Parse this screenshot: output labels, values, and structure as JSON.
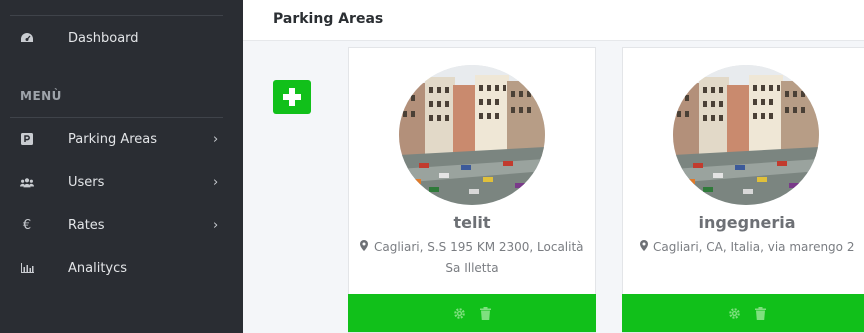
{
  "sidebar": {
    "dashboard": {
      "label": "Dashboard",
      "icon": "dashboard-gauge-icon"
    },
    "section_label": "MENÙ",
    "items": [
      {
        "label": "Parking Areas",
        "icon": "parking-icon",
        "chevron": "›"
      },
      {
        "label": "Users",
        "icon": "users-icon",
        "chevron": "›"
      },
      {
        "label": "Rates",
        "icon": "euro-icon",
        "chevron": "›"
      },
      {
        "label": "Analitycs",
        "icon": "bar-chart-icon"
      }
    ]
  },
  "header": {
    "title": "Parking Areas"
  },
  "add_button": {
    "icon": "plus-icon"
  },
  "cards": [
    {
      "name": "telit",
      "address": "Cagliari, S.S 195 KM 2300, Località Sa Illetta"
    },
    {
      "name": "ingegneria",
      "address": "Cagliari, CA, Italia, via marengo 2"
    }
  ],
  "colors": {
    "sidebar_bg": "#2a2d33",
    "accent_green": "#11c01a",
    "page_bg": "#f4f6f9"
  }
}
